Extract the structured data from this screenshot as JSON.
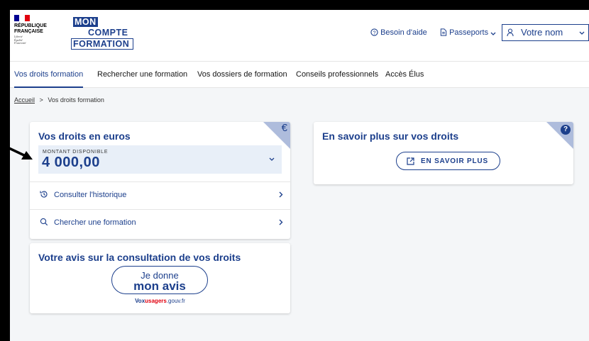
{
  "header": {
    "republic_line1": "RÉPUBLIQUE",
    "republic_line2": "FRANÇAISE",
    "devise": [
      "Liberté",
      "Égalité",
      "Fraternité"
    ],
    "logo": [
      "MON",
      "COMPTE",
      "FORMATION"
    ],
    "help_label": "Besoin d'aide",
    "passports_label": "Passeports",
    "user_label": "Votre nom",
    "colors": {
      "flag_blue": "#000091",
      "flag_red": "#e1000f",
      "brand_blue": "#1c3f8c"
    }
  },
  "nav": {
    "items": [
      {
        "label": "Vos droits formation",
        "active": true
      },
      {
        "label": "Rechercher une formation"
      },
      {
        "label": "Vos dossiers de formation"
      },
      {
        "label": "Conseils professionnels"
      },
      {
        "label": "Accès Élus"
      }
    ]
  },
  "breadcrumb": {
    "home": "Accueil",
    "separator": ">",
    "current": "Vos droits formation"
  },
  "rights_card": {
    "title": "Vos droits en euros",
    "corner_symbol": "€",
    "amount_label": "MONTANT DISPONIBLE",
    "amount_value": "4 000,00",
    "history_label": "Consulter l'historique",
    "search_label": "Chercher une formation"
  },
  "info_card": {
    "title": "En savoir plus sur vos droits",
    "button_label": "EN SAVOIR PLUS",
    "help_symbol": "?"
  },
  "feedback_card": {
    "title": "Votre avis sur la consultation de vos droits",
    "button_line1": "Je donne",
    "button_line2": "mon avis",
    "vox_part1": "Vox",
    "vox_part2": "usagers",
    "vox_part3": ".gouv.fr"
  }
}
